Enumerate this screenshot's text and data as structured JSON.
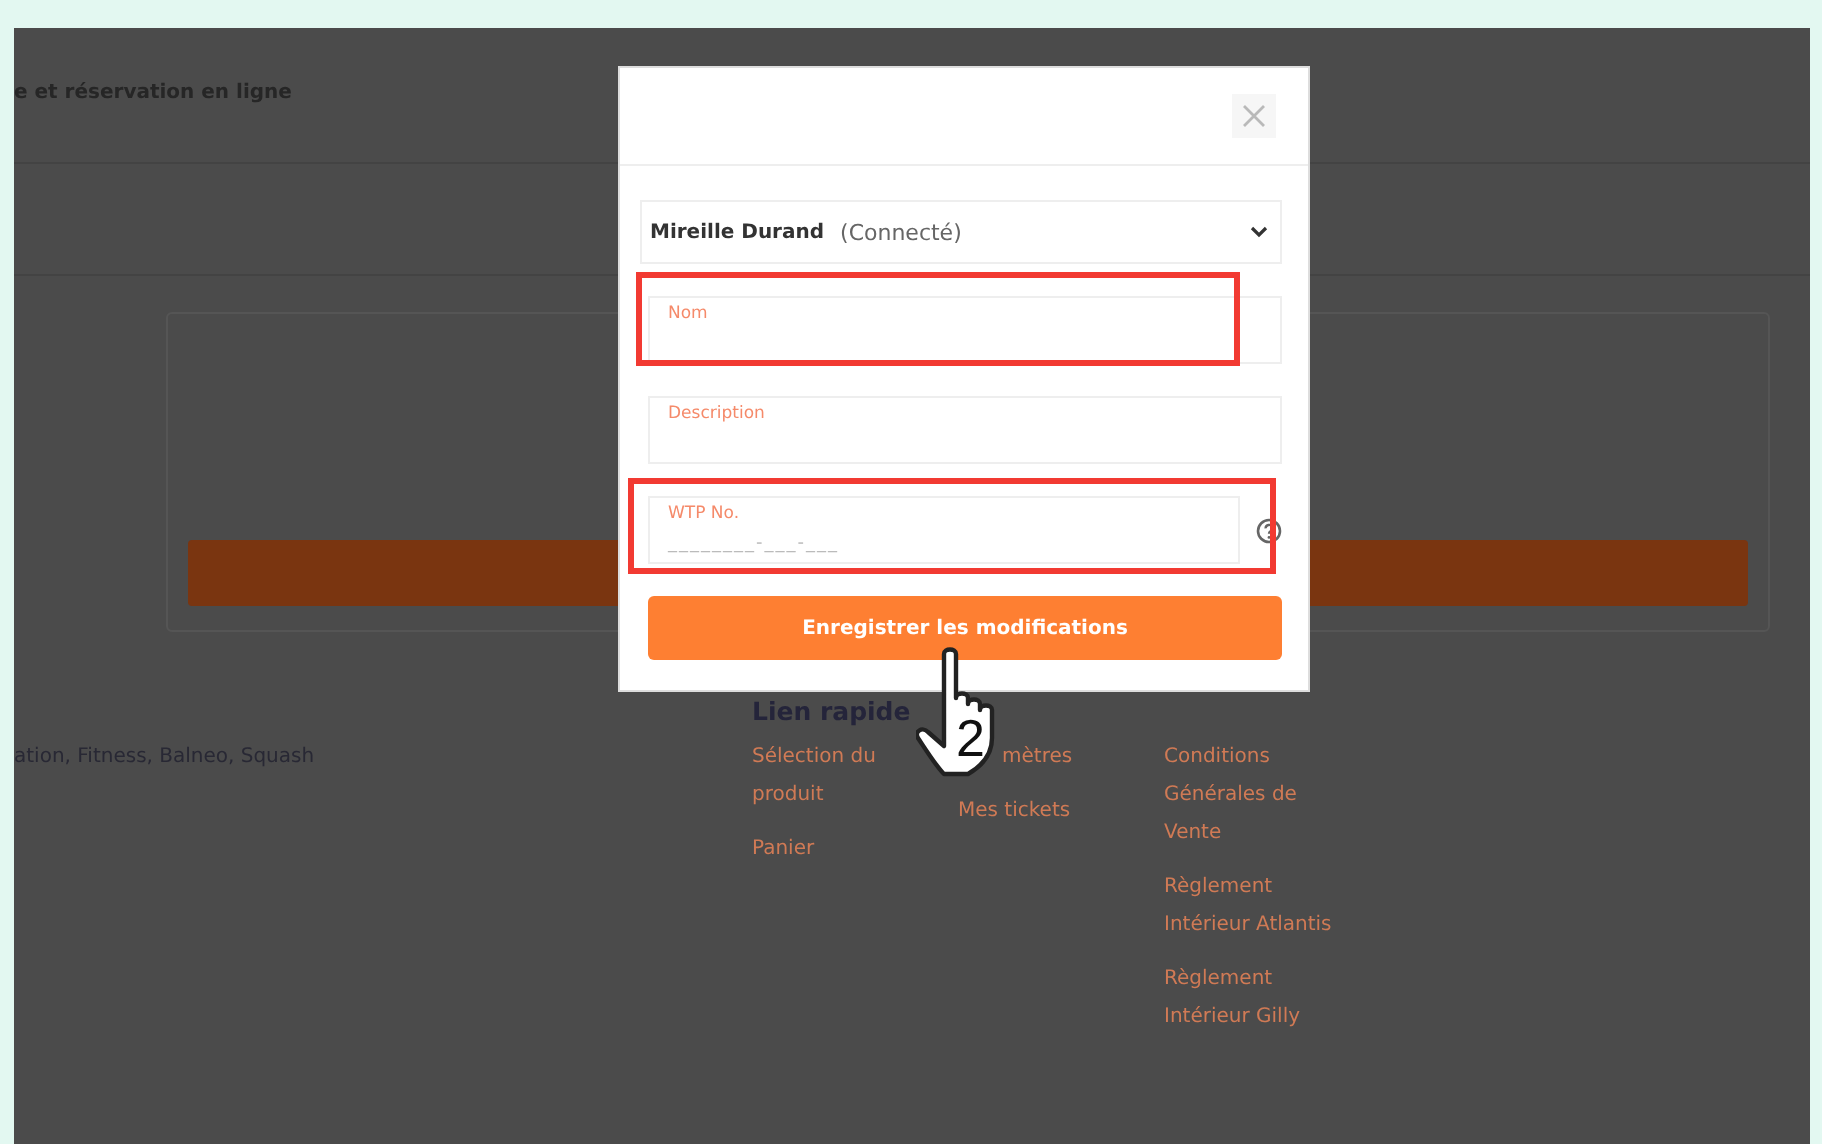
{
  "page": {
    "header_title": "e et réservation en ligne",
    "footer_text": "ation, Fitness, Balneo, Squash",
    "quick_links": {
      "title": "Lien rapide",
      "columns": [
        [
          "Sélection du produit",
          "Panier"
        ],
        [
          "mètres",
          "Mes tickets"
        ],
        [
          "Conditions Générales de Vente",
          "Règlement Intérieur Atlantis",
          "Règlement Intérieur Gilly"
        ]
      ]
    }
  },
  "modal": {
    "account": {
      "name": "Mireille Durand",
      "status": "(Connecté)"
    },
    "fields": [
      {
        "label": "Nom",
        "kind": "text"
      },
      {
        "label": "Description",
        "kind": "text"
      },
      {
        "label": "WTP No.",
        "placeholder": "________-___-___",
        "kind": "help"
      }
    ],
    "save_button": "Enregistrer les modifications"
  },
  "annotation": {
    "step": "2"
  }
}
